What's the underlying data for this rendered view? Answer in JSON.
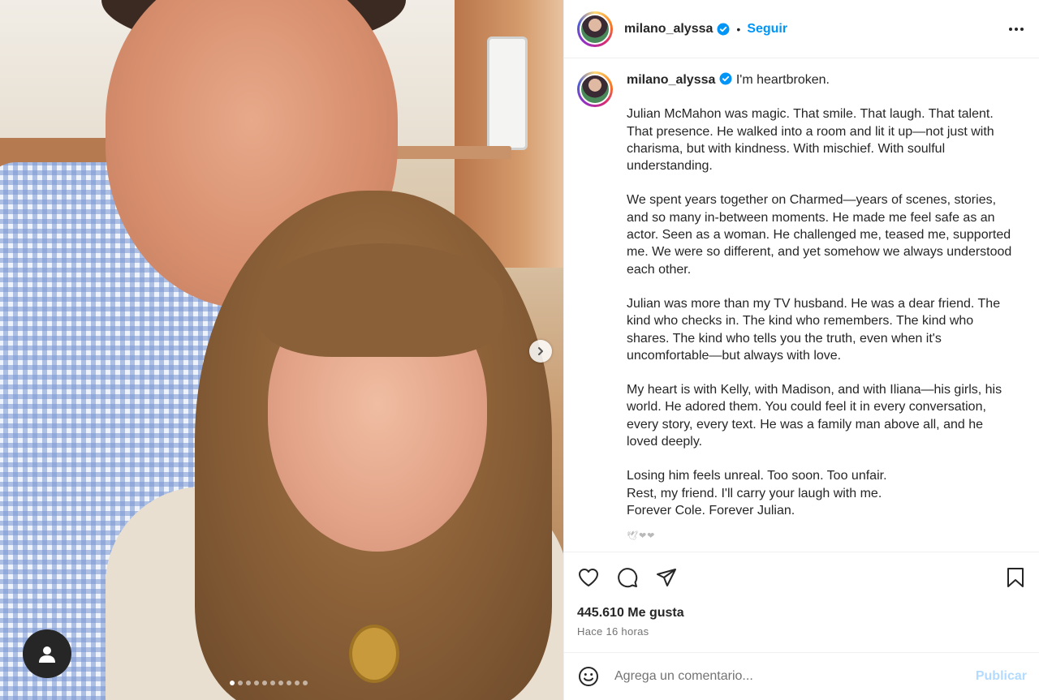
{
  "post": {
    "username": "milano_alyssa",
    "follow_label": "Seguir",
    "separator": "•",
    "caption_first_line": "I'm heartbroken.",
    "caption_paragraphs": [
      "Julian McMahon was magic. That smile. That laugh. That talent. That presence. He walked into a room and lit it up—not just with charisma, but with kindness. With mischief. With soulful understanding.",
      "We spent years together on Charmed—years of scenes, stories, and so many in-between moments. He made me feel safe as an actor. Seen as a woman. He challenged me, teased me, supported me. We were so different, and yet somehow we always understood each other.",
      "Julian was more than my TV husband. He was a dear friend. The kind who checks in. The kind who remembers. The kind who shares. The kind who tells you the truth, even when it's uncomfortable—but always with love.",
      "My heart is with Kelly, with Madison, and with Iliana—his girls, his world. He adored them. You could feel it in every conversation, every story, every text. He was a family man above all, and he loved deeply.",
      "Losing him feels unreal. Too soon. Too unfair.",
      "Rest, my friend. I'll carry your laugh with me.",
      "Forever Cole. Forever Julian."
    ],
    "emoji_line": "🕊❤❤",
    "likes": "445.610 Me gusta",
    "time_ago": "Hace 16 horas",
    "comment_placeholder": "Agrega un comentario...",
    "publish_label": "Publicar"
  },
  "carousel": {
    "total_slides": 10,
    "active_index": 0
  },
  "colors": {
    "accent": "#0095f6",
    "publish_disabled": "#b3dbff",
    "text": "#262626",
    "muted": "#737373"
  },
  "icons": [
    "verified-icon",
    "more-options-icon",
    "like-heart-icon",
    "comment-icon",
    "share-icon",
    "save-bookmark-icon",
    "emoji-icon",
    "next-arrow-icon",
    "user-tag-icon"
  ]
}
